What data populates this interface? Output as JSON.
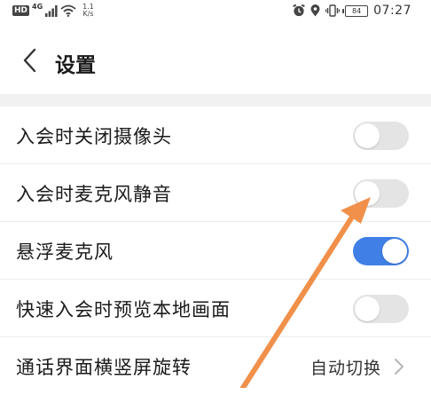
{
  "status_bar": {
    "hd": "HD",
    "net_type": "4G",
    "speed_value": "1.1",
    "speed_unit": "K/s",
    "battery": "84",
    "time": "07:27"
  },
  "header": {
    "title": "设置"
  },
  "settings": {
    "items": [
      {
        "label": "入会时关闭摄像头",
        "toggle": "off"
      },
      {
        "label": "入会时麦克风静音",
        "toggle": "off"
      },
      {
        "label": "悬浮麦克风",
        "toggle": "on"
      },
      {
        "label": "快速入会时预览本地画面",
        "toggle": "off"
      },
      {
        "label": "通话界面横竖屏旋转",
        "value": "自动切换"
      }
    ]
  },
  "colors": {
    "toggle_on": "#3f7fe6",
    "toggle_off": "#e4e4e4",
    "annotation_arrow": "#f0904a"
  },
  "icons": {
    "back": "chevron-left-icon",
    "navigate": "chevron-right-icon",
    "wifi": "wifi-icon",
    "alarm": "alarm-icon",
    "location": "location-icon",
    "vibrate": "vibrate-icon",
    "battery": "battery-icon",
    "annotation": "arrow-icon"
  }
}
